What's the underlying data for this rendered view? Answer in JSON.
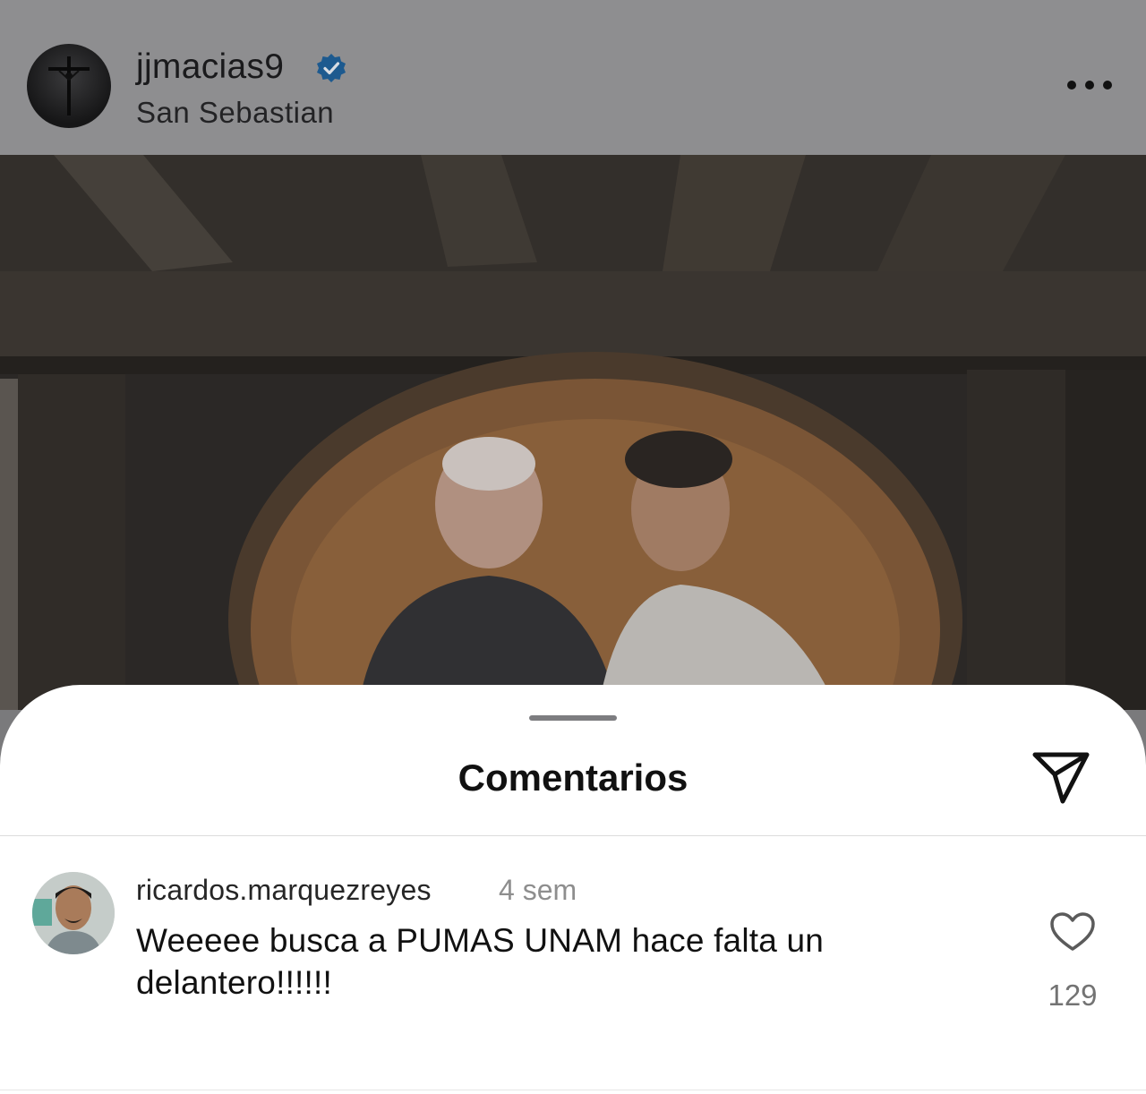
{
  "post": {
    "username": "jjmacias9",
    "location": "San Sebastian",
    "verified_icon": "verified-badge-icon",
    "more_icon": "more-options-icon"
  },
  "comments_sheet": {
    "title": "Comentarios",
    "share_icon": "send-icon",
    "comments": [
      {
        "username": "ricardos.marquezreyes",
        "time": "4 sem",
        "text": "Weeeee busca a PUMAS UNAM hace falta un delantero!!!!!!",
        "like_icon": "heart-outline-icon",
        "likes": "129"
      }
    ]
  },
  "colors": {
    "verified": "#1d6fb8",
    "overlay": "#8e8e90"
  }
}
